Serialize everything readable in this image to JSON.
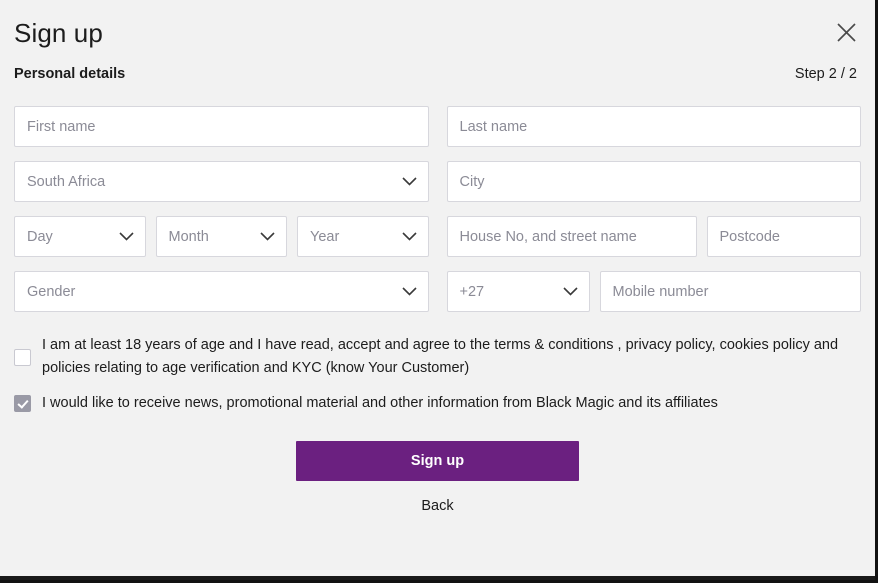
{
  "header": {
    "title": "Sign up",
    "close_icon": "close-icon"
  },
  "subheader": {
    "section_label": "Personal details",
    "step_label": "Step 2 / 2"
  },
  "form": {
    "first_name_placeholder": "First name",
    "last_name_placeholder": "Last name",
    "country_value": "South Africa",
    "city_placeholder": "City",
    "day_value": "Day",
    "month_value": "Month",
    "year_value": "Year",
    "street_placeholder": "House No, and street name",
    "postcode_placeholder": "Postcode",
    "gender_value": "Gender",
    "dial_code_value": "+27",
    "mobile_placeholder": "Mobile number"
  },
  "consents": {
    "terms_text": "I am at least 18 years of age and I have read, accept and agree to the terms & conditions , privacy policy, cookies policy and policies relating to age verification and KYC (know Your Customer)",
    "terms_checked": false,
    "marketing_text": "I would like to receive news, promotional material and other information from Black Magic and its affiliates",
    "marketing_checked": true
  },
  "actions": {
    "submit_label": "Sign up",
    "back_label": "Back"
  },
  "colors": {
    "accent": "#6b2080",
    "background": "#f2f2f2",
    "field_border": "#d7d7dd",
    "placeholder": "#8b8b96",
    "checkbox_checked": "#9a9aa6"
  }
}
